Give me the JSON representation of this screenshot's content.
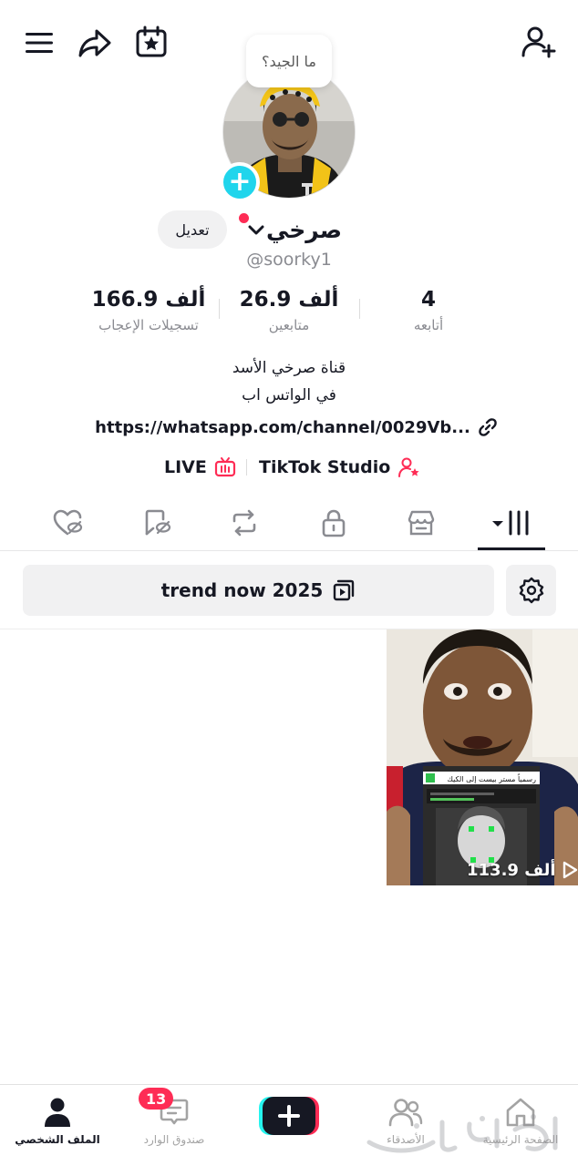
{
  "bubble": {
    "text": "ما الجيد؟"
  },
  "profile": {
    "display_name": "صرخي",
    "username": "@soorky1",
    "edit_label": "تعديل"
  },
  "stats": {
    "likes": {
      "value": "166.9 ألف",
      "label": "تسجيلات الإعجاب"
    },
    "followers": {
      "value": "26.9 ألف",
      "label": "متابعين"
    },
    "following": {
      "value": "4",
      "label": "أتابعه"
    }
  },
  "bio": {
    "line1": "قناة صرخي الأسد",
    "line2": "في الواتس اب",
    "link": "https://whatsapp.com/channel/0029Vb..."
  },
  "studio_row": {
    "live_label": "LIVE",
    "studio_label": "TikTok Studio"
  },
  "tabs": [
    "videos-grid",
    "store",
    "private",
    "reposts",
    "favorites",
    "liked"
  ],
  "playlist": {
    "label": "trend now 2025"
  },
  "video": {
    "views": "113.9 ألف",
    "caption_overlay": "رسمياً مستر بيست إلى الكيك"
  },
  "nav": {
    "profile": "الملف الشخصي",
    "inbox": "صندوق الوارد",
    "inbox_badge": "13",
    "friends": "الأصدقاء",
    "home": "الصفحة الرئيسية"
  },
  "colors": {
    "accent": "#fe2c55",
    "cyan": "#20d5ec",
    "text": "#161823",
    "muted": "#8a8b91"
  }
}
